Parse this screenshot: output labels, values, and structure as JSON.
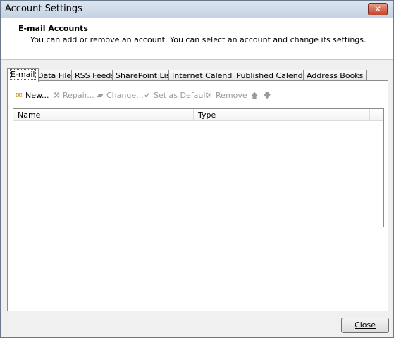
{
  "window": {
    "title": "Account Settings",
    "close_glyph": "✕"
  },
  "header": {
    "title": "E-mail Accounts",
    "description": "You can add or remove an account. You can select an account and change its settings."
  },
  "tabs": [
    {
      "label": "E-mail",
      "active": true
    },
    {
      "label": "Data Files"
    },
    {
      "label": "RSS Feeds"
    },
    {
      "label": "SharePoint Lists"
    },
    {
      "label": "Internet Calendars"
    },
    {
      "label": "Published Calendars"
    },
    {
      "label": "Address Books"
    }
  ],
  "toolbar": {
    "new_label": "New...",
    "repair_label": "Repair...",
    "change_label": "Change...",
    "set_default_label": "Set as Default",
    "remove_label": "Remove",
    "up_glyph": "🡅",
    "down_glyph": "🡇"
  },
  "list": {
    "columns": [
      "Name",
      "Type"
    ],
    "rows": []
  },
  "footer": {
    "close_label": "Close"
  }
}
